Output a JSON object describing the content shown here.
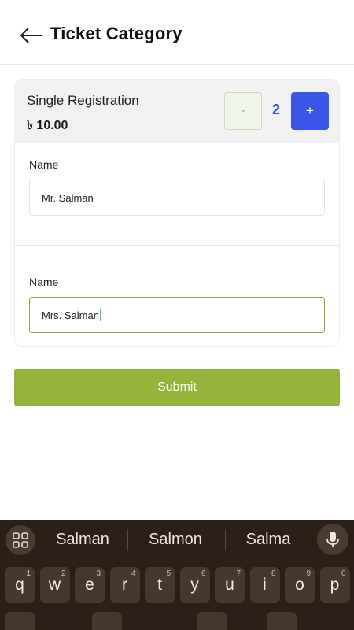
{
  "header": {
    "title": "Ticket Category",
    "back_icon": "arrow-left-icon"
  },
  "ticket": {
    "name": "Single Registration",
    "price": "৳ 10.00",
    "minus_label": "-",
    "quantity": "2",
    "plus_label": "+"
  },
  "attendees": [
    {
      "label": "Name",
      "value": "Mr. Salman"
    },
    {
      "label": "Name",
      "value": "Mrs. Salman"
    }
  ],
  "submit_label": "Submit",
  "keyboard": {
    "suggestions": [
      "Salman",
      "Salmon",
      "Salma"
    ],
    "row1": [
      {
        "k": "q",
        "n": "1"
      },
      {
        "k": "w",
        "n": "2"
      },
      {
        "k": "e",
        "n": "3"
      },
      {
        "k": "r",
        "n": "4"
      },
      {
        "k": "t",
        "n": "5"
      },
      {
        "k": "y",
        "n": "6"
      },
      {
        "k": "u",
        "n": "7"
      },
      {
        "k": "i",
        "n": "8"
      },
      {
        "k": "o",
        "n": "9"
      },
      {
        "k": "p",
        "n": "0"
      }
    ]
  },
  "colors": {
    "accent_green": "#95b23a",
    "accent_blue": "#3b57e8",
    "keyboard_bg": "#2b1f17"
  }
}
